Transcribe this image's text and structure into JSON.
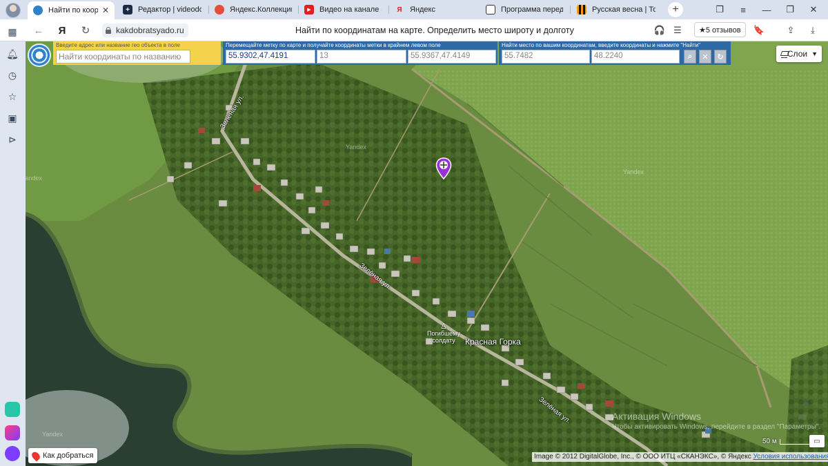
{
  "tabs": [
    {
      "label": "Найти по координ",
      "active": true
    },
    {
      "label": "Редактор | videodoro"
    },
    {
      "label": "Яндекс.Коллекции"
    },
    {
      "label": "Видео на канале - Yo"
    },
    {
      "label": "Яндекс"
    },
    {
      "label": "Программа передач"
    },
    {
      "label": "Русская весна | Толь"
    }
  ],
  "tab_close_glyph": "✕",
  "new_tab_glyph": "+",
  "address": {
    "domain": "kakdobratsyado.ru",
    "page_title": "Найти по координатам на карте. Определить место широту и долготу",
    "reviews": "★5 отзывов",
    "yandex_glyph": "Я"
  },
  "map_controls": {
    "address_hint": "Введите адрес или название гео объекта в поле",
    "address_placeholder": "Найти координаты по названию",
    "mark_hint": "Перемещайте метку по карте и получайте координаты метки в крайнем левом поле",
    "mark_coords": "55.9302,47.4191",
    "zoom": "13",
    "corner_coords": "55.9367,47.4149",
    "find_hint": "Найти место по вашим координатам, введите координаты и нажмите \"Найти\"",
    "lat_placeholder": "55.7482",
    "lon_placeholder": "48.2240",
    "layers_label": "Слои",
    "route_label": "Как добраться",
    "scale_label": "50 м"
  },
  "map_labels": {
    "street_1": "Зелёная ул.",
    "street_2": "Зелёная ул.",
    "street_3": "Зелёная ул.",
    "monument": "Погибшему\nсолдату",
    "place": "Красная Горка",
    "yandex_1": "Yandex",
    "yandex_2": "Yandex",
    "yandex_3": "Yandex",
    "yandex_4": "Yandex"
  },
  "copyright": {
    "text": "Image © 2012 DigitalGlobe, Inc., © ООО ИТЦ «СКАНЭКС», © Яндекс",
    "link": "Условия использования"
  },
  "windows_watermark": {
    "title": "Активация Windows",
    "sub": "Чтобы активировать Windows, перейдите в раздел \"Параметры\"."
  },
  "colors": {
    "accent_yellow": "#f5d24b",
    "panel_blue": "#2d6aa5",
    "marker_purple": "#9b2fd6"
  }
}
